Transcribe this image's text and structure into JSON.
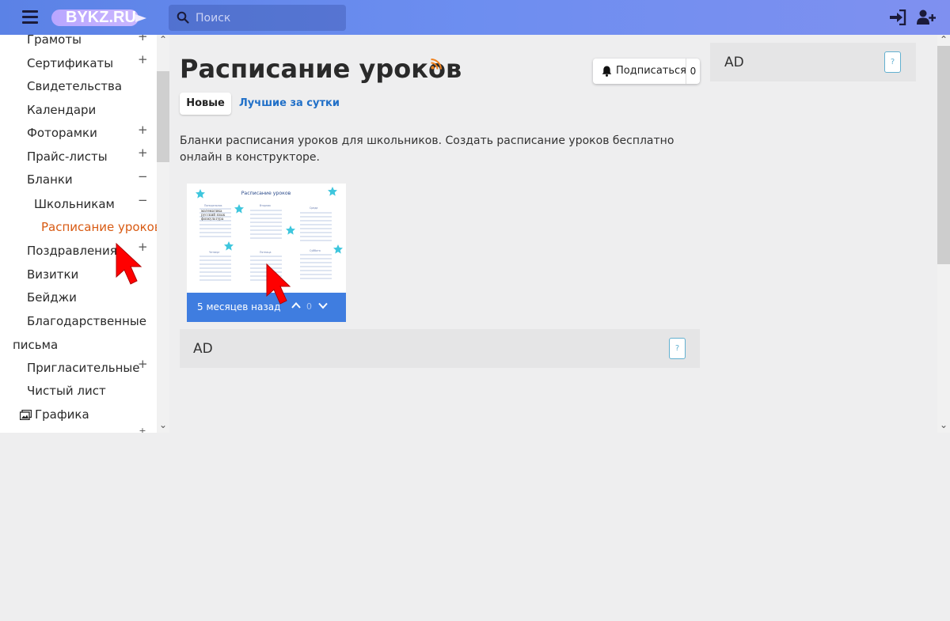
{
  "header": {
    "logo": "BYKZ.RU",
    "search_placeholder": "Поиск"
  },
  "sidebar": {
    "items": [
      {
        "label": "Грамоты",
        "toggle": "+"
      },
      {
        "label": "Сертификаты",
        "toggle": "+"
      },
      {
        "label": "Свидетельства",
        "toggle": ""
      },
      {
        "label": "Календари",
        "toggle": ""
      },
      {
        "label": "Фоторамки",
        "toggle": "+"
      },
      {
        "label": "Прайс-листы",
        "toggle": "+"
      },
      {
        "label": "Бланки",
        "toggle": "−"
      },
      {
        "label": "Школьникам",
        "toggle": "−"
      },
      {
        "label": "Расписание уроков",
        "toggle": "",
        "active": true
      },
      {
        "label": "Поздравления",
        "toggle": "+"
      },
      {
        "label": "Визитки",
        "toggle": ""
      },
      {
        "label": "Бейджи",
        "toggle": ""
      },
      {
        "label": "Благодарственные",
        "toggle": ""
      },
      {
        "label": "письма",
        "toggle": ""
      },
      {
        "label": "Пригласительные",
        "toggle": "+"
      },
      {
        "label": "Чистый лист",
        "toggle": ""
      },
      {
        "label": "Графика",
        "toggle": ""
      }
    ]
  },
  "main": {
    "title": "Расписание уроков",
    "subscribe_label": "Подписаться",
    "subscribe_count": "0",
    "tabs": [
      {
        "label": "Новые",
        "active": true
      },
      {
        "label": "Лучшие за сутки",
        "active": false
      }
    ],
    "description": "Бланки расписания уроков для школьников. Создать расписание уроков бесплатно онлайн в конструкторе.",
    "card": {
      "thumb_title": "Расписание уроков",
      "days": [
        "Понедельник",
        "Вторник",
        "Среда",
        "Четверг",
        "Пятница",
        "Суббота"
      ],
      "subjects": [
        "математика",
        "русский язык",
        "физкультура"
      ],
      "date": "5 месяцев назад",
      "votes": "0"
    },
    "ad_main": {
      "label": "AD",
      "help": "?"
    }
  },
  "right": {
    "ad": {
      "label": "AD",
      "help": "?"
    }
  },
  "colors": {
    "header_gradient_start": "#5b82e6",
    "header_gradient_end": "#7f90f0",
    "active_link": "#d85a12",
    "tab_link": "#2170c8",
    "card_bar": "#3f7de0",
    "cursor": "#ff0000"
  },
  "icons": [
    "menu-icon",
    "search-icon",
    "login-icon",
    "user-add-icon",
    "rss-icon",
    "bell-icon",
    "chevron-up-icon",
    "chevron-down-icon",
    "images-icon",
    "star-icon",
    "pointer-arrow-icon"
  ]
}
